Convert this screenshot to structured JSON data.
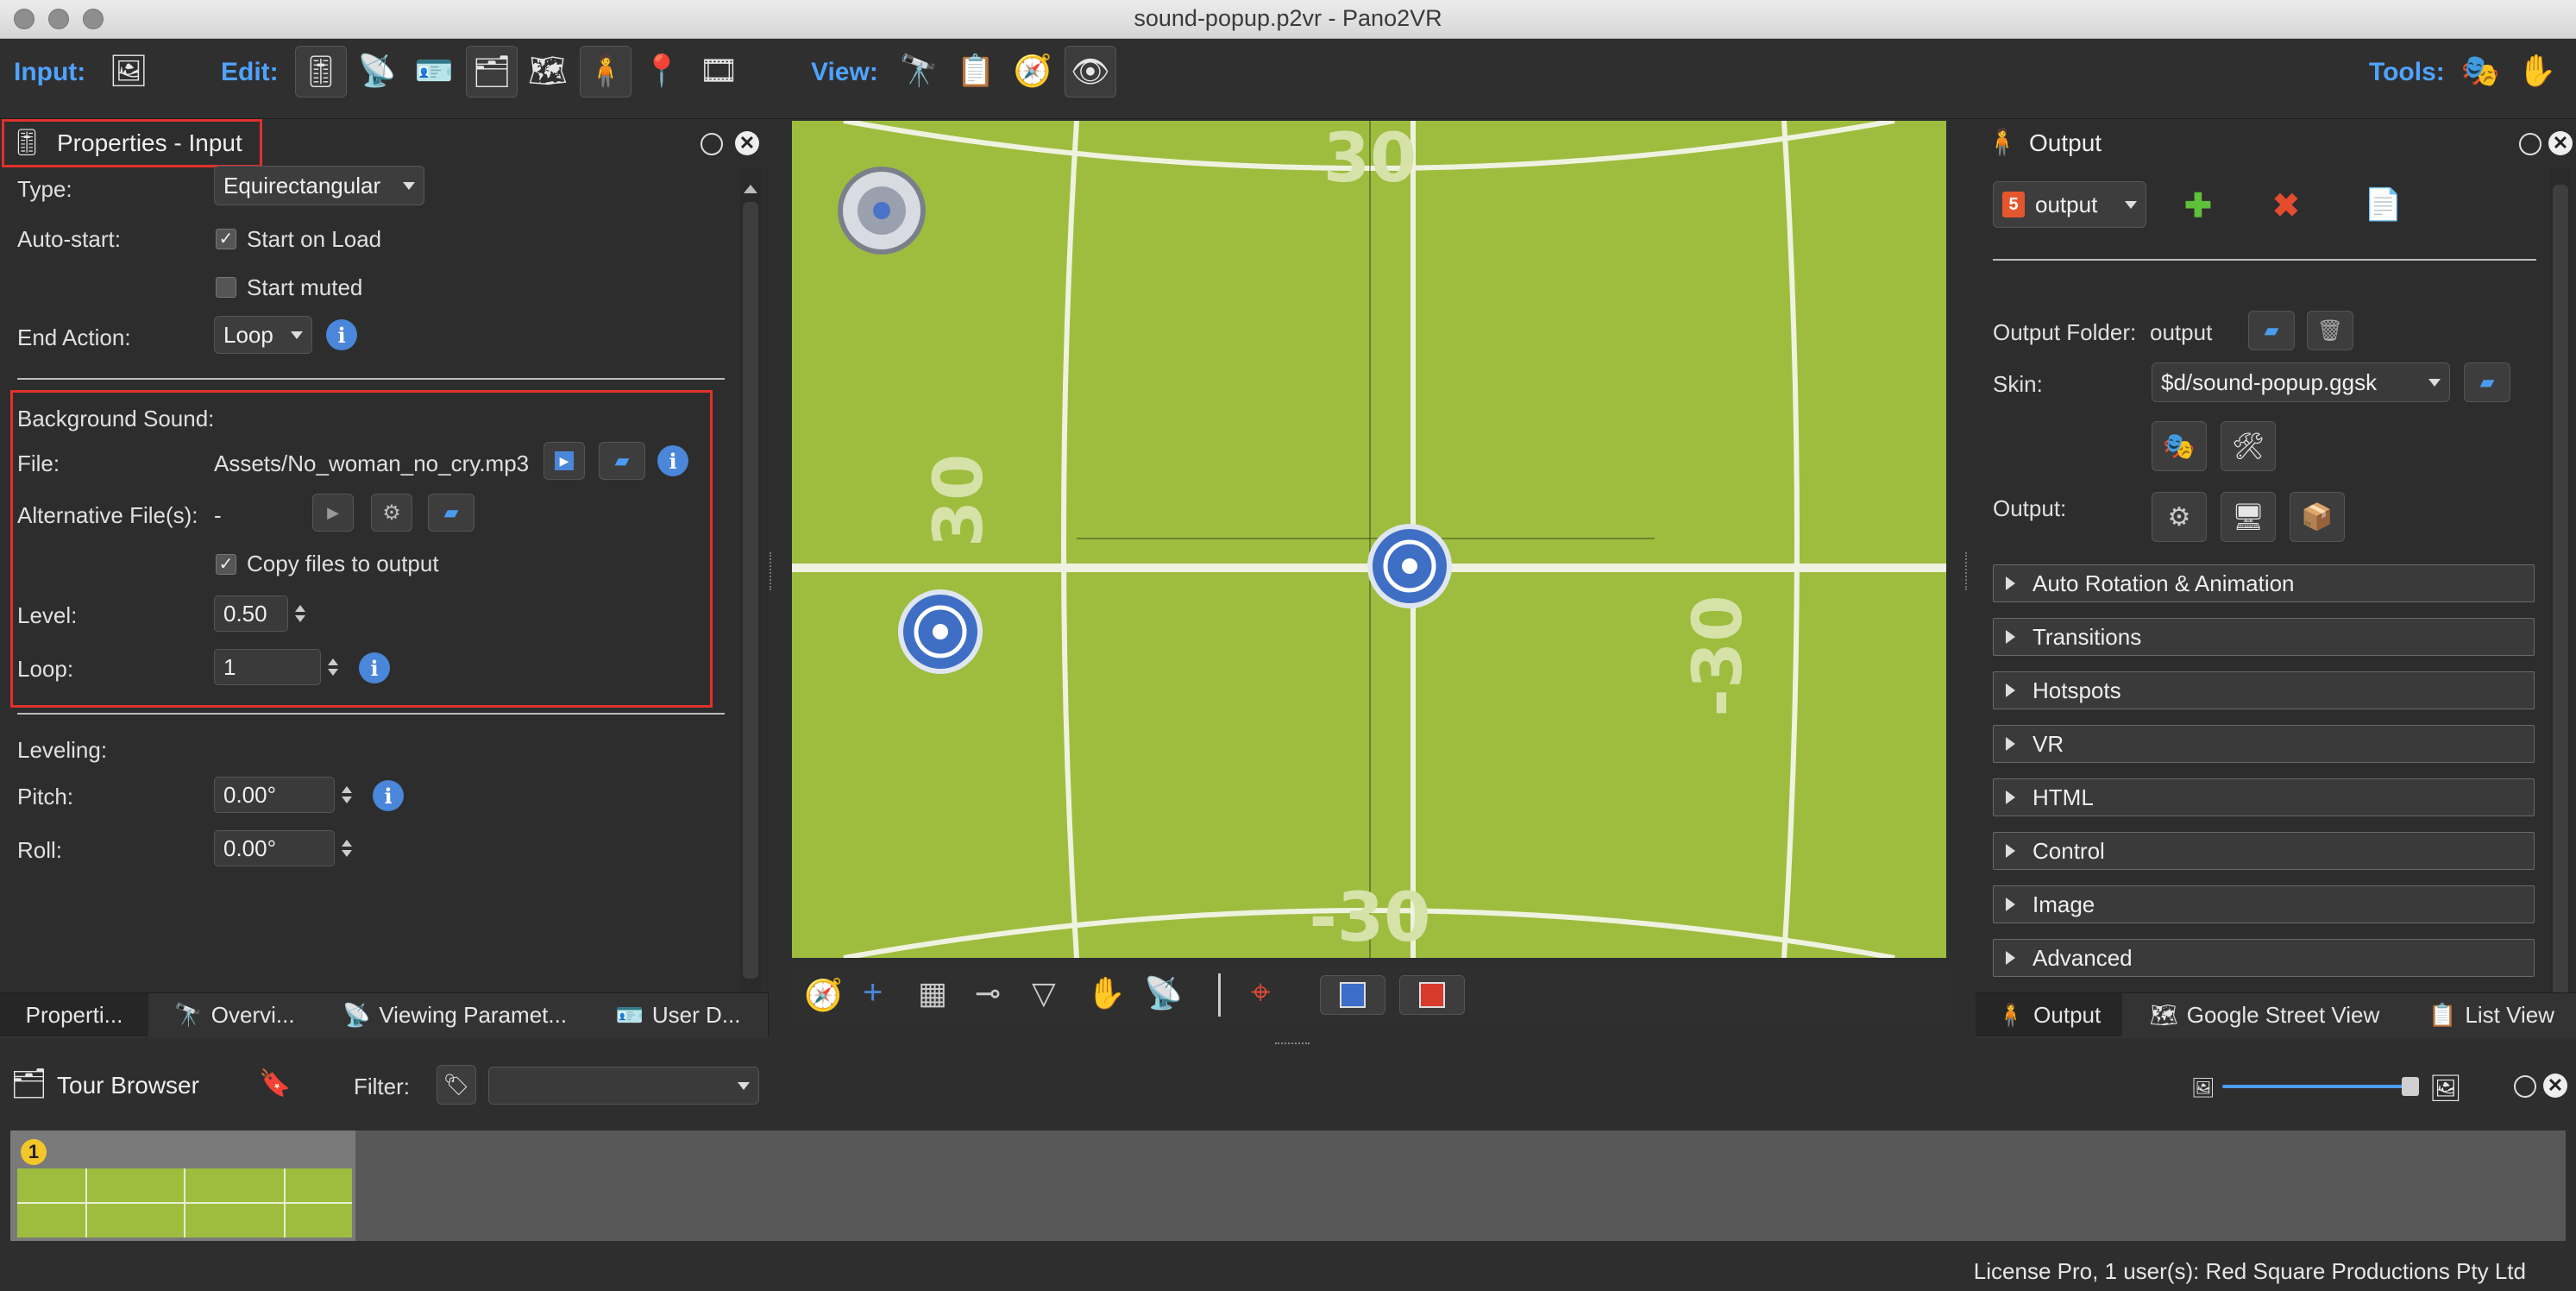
{
  "window": {
    "title": "sound-popup.p2vr - Pano2VR"
  },
  "toolbar": {
    "input_label": "Input:",
    "edit_label": "Edit:",
    "view_label": "View:",
    "tools_label": "Tools:"
  },
  "properties_panel": {
    "title": "Properties - Input",
    "type_label": "Type:",
    "type_value": "Equirectangular",
    "autostart_label": "Auto-start:",
    "start_on_load": "Start on Load",
    "start_on_load_checked": "✓",
    "start_muted": "Start muted",
    "end_action_label": "End Action:",
    "end_action_value": "Loop",
    "info_glyph": "i",
    "background_sound": {
      "heading": "Background Sound:",
      "file_label": "File:",
      "file_value": "Assets/No_woman_no_cry.mp3",
      "alt_files_label": "Alternative File(s):",
      "alt_files_value": "-",
      "copy_files": "Copy files to output",
      "copy_files_checked": "✓",
      "level_label": "Level:",
      "level_value": "0.50",
      "loop_label": "Loop:",
      "loop_value": "1"
    },
    "leveling": {
      "heading": "Leveling:",
      "pitch_label": "Pitch:",
      "pitch_value": "0.00°",
      "roll_label": "Roll:",
      "roll_value": "0.00°"
    },
    "tabs": [
      "Properti...",
      "Overvi...",
      "Viewing Paramet...",
      "User D..."
    ]
  },
  "viewer": {
    "grid_labels": {
      "top": "30",
      "left": "30",
      "right": "-30",
      "bottom": "-30"
    },
    "colors": {
      "background": "#9ebd3f",
      "lines": "#f0f2e0",
      "label": "#d6e2a8"
    }
  },
  "output_panel": {
    "title": "Output",
    "format": "output",
    "output_folder_label": "Output Folder:",
    "output_folder_value": "output",
    "skin_label": "Skin:",
    "skin_value": "$d/sound-popup.ggsk",
    "output_label": "Output:",
    "sections": [
      "Auto Rotation & Animation",
      "Transitions",
      "Hotspots",
      "VR",
      "HTML",
      "Control",
      "Image",
      "Advanced"
    ],
    "tabs": [
      "Output",
      "Google Street View",
      "List View"
    ]
  },
  "tour_browser": {
    "title": "Tour Browser",
    "filter_label": "Filter:",
    "filter_value": "",
    "thumbnail_badge": "1"
  },
  "status_bar": {
    "text": "License Pro, 1 user(s): Red Square Productions Pty Ltd"
  }
}
